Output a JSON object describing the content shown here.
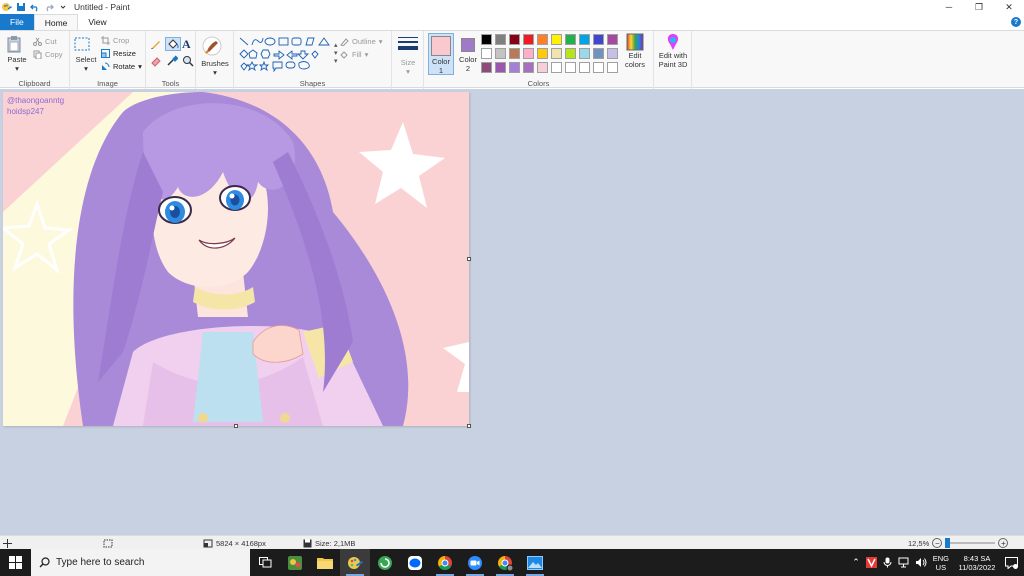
{
  "window": {
    "title": "Untitled - Paint",
    "controls": {
      "minimize": "─",
      "restore": "❐",
      "close": "✕"
    }
  },
  "tabs": [
    {
      "label": "File"
    },
    {
      "label": "Home"
    },
    {
      "label": "View"
    }
  ],
  "ribbon": {
    "clipboard": {
      "group_label": "Clipboard",
      "paste": "Paste",
      "cut": "Cut",
      "copy": "Copy"
    },
    "image": {
      "group_label": "Image",
      "select": "Select",
      "crop": "Crop",
      "resize": "Resize",
      "rotate": "Rotate"
    },
    "tools": {
      "group_label": "Tools",
      "text_tool": "A"
    },
    "brushes": {
      "label": "Brushes"
    },
    "shapes": {
      "group_label": "Shapes",
      "outline": "Outline",
      "fill": "Fill"
    },
    "size": {
      "label": "Size"
    },
    "colors": {
      "group_label": "Colors",
      "color1_label": "Color",
      "color1_num": "1",
      "color2_label": "Color",
      "color2_num": "2",
      "color1": "#f9c9cf",
      "color2": "#a07ac8",
      "edit_colors_line1": "Edit",
      "edit_colors_line2": "colors",
      "paint3d_line1": "Edit with",
      "paint3d_line2": "Paint 3D",
      "palette": [
        "#000000",
        "#7f7f7f",
        "#880015",
        "#ed1c24",
        "#ff7f27",
        "#fff200",
        "#22b14c",
        "#00a2e8",
        "#3f48cc",
        "#a349a4",
        "#ffffff",
        "#c3c3c3",
        "#b97a57",
        "#ffaec9",
        "#ffc90e",
        "#efe4b0",
        "#b5e61d",
        "#99d9ea",
        "#7092be",
        "#c8bfe7",
        "#8e4a79",
        "#9b56b0",
        "#a67fd6",
        "#a570c0",
        "#f6d0d6",
        "#ffffff",
        "#ffffff",
        "#ffffff",
        "#ffffff",
        "#ffffff"
      ]
    }
  },
  "canvas": {
    "watermark_line1": "@thaongoanntg",
    "watermark_line2": "hoidsp247",
    "background": "#fbd2d3"
  },
  "statusbar": {
    "dimensions": "5824 × 4168px",
    "size": "Size: 2,1MB",
    "zoom": "12,5%",
    "zoom_minus": "−",
    "zoom_plus": "+"
  },
  "taskbar": {
    "search_placeholder": "Type here to search",
    "language_line1": "ENG",
    "language_line2": "US",
    "time": "8:43 SA",
    "date": "11/03/2022"
  }
}
